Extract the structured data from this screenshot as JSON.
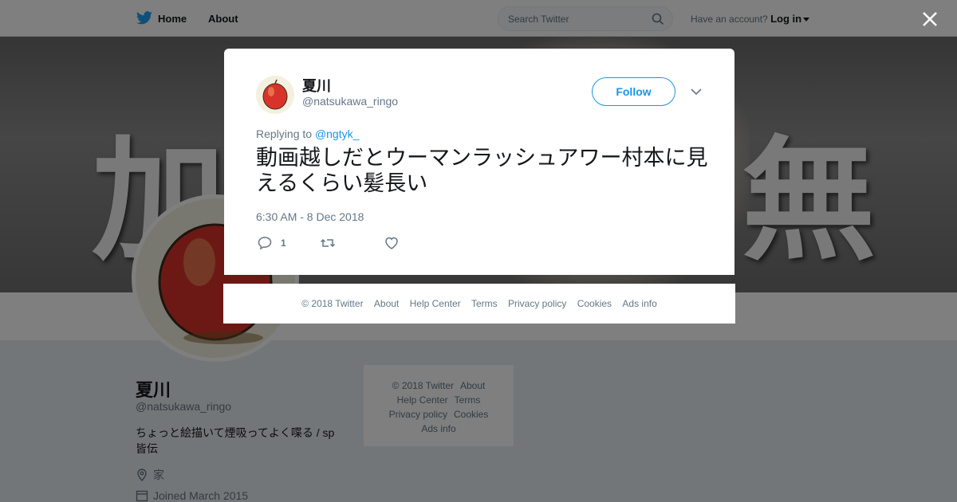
{
  "topbar": {
    "home_label": "Home",
    "about_label": "About",
    "search_placeholder": "Search Twitter",
    "account_prompt": "Have an account?",
    "login_label": "Log in"
  },
  "banner": {
    "left_text": "加",
    "right_text": "無"
  },
  "profile": {
    "name": "夏川",
    "handle": "@natsukawa_ringo",
    "bio": "ちょっと絵描いて煙吸ってよく喋る / sp 皆伝",
    "location": "家",
    "joined": "Joined March 2015"
  },
  "side_footer": {
    "copyright": "© 2018 Twitter",
    "about": "About",
    "help": "Help Center",
    "terms": "Terms",
    "privacy": "Privacy policy",
    "cookies": "Cookies",
    "ads": "Ads info"
  },
  "tweet": {
    "author_name": "夏川",
    "author_handle": "@natsukawa_ringo",
    "follow_label": "Follow",
    "replying_prefix": "Replying to",
    "replying_to": "@ngtyk_",
    "text": "動画越しだとウーマンラッシュアワー村本に見えるくらい髪長い",
    "timestamp": "6:30 AM - 8 Dec 2018",
    "reply_count": "1",
    "retweet_count": "",
    "like_count": ""
  },
  "modal_footer": {
    "copyright": "© 2018 Twitter",
    "about": "About",
    "help": "Help Center",
    "terms": "Terms",
    "privacy": "Privacy policy",
    "cookies": "Cookies",
    "ads": "Ads info"
  },
  "colors": {
    "accent": "#1b95e0",
    "text_primary": "#14171a",
    "text_secondary": "#657786",
    "background": "#e6ecf0",
    "overlay": "rgba(0,0,0,0.5)"
  },
  "icons": [
    "twitter-bird-icon",
    "search-icon",
    "caret-down-icon",
    "close-icon",
    "chevron-down-icon",
    "reply-icon",
    "retweet-icon",
    "heart-icon",
    "location-pin-icon",
    "calendar-icon",
    "apple-avatar-icon"
  ]
}
